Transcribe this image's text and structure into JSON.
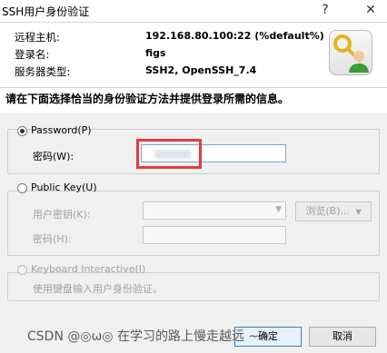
{
  "window": {
    "title": "SSH用户身份验证",
    "help_glyph": "?",
    "close_glyph": "✕"
  },
  "info": {
    "remote_host_label": "远程主机:",
    "remote_host_value": "192.168.80.100:22 (%default%)",
    "login_name_label": "登录名:",
    "login_name_value": "figs",
    "server_type_label": "服务器类型:",
    "server_type_value": "SSH2, OpenSSH_7.4",
    "key_icon": "keys-user-icon"
  },
  "instruction": "请在下面选择恰当的身份验证方法并提供登录所需的信息。",
  "password": {
    "radio_label": "Password(P)",
    "selected": true,
    "field_label": "密码(W):",
    "value_masked": ""
  },
  "public_key": {
    "radio_label": "Public Key(U)",
    "selected": false,
    "user_key_label": "用户密钥(K):",
    "user_key_value": "",
    "browse_label": "浏览(B)...",
    "passphrase_label": "密码(H):"
  },
  "keyboard_interactive": {
    "radio_label": "Keyboard Interactive(I)",
    "enabled": false,
    "description": "使用键盘输入用户身份验证。"
  },
  "buttons": {
    "ok_label": "确定",
    "cancel_label": "取消"
  },
  "watermark": "CSDN @◎ω◎ 在学习的路上慢走越远 ~~",
  "colors": {
    "highlight_box": "#e23b3b",
    "panel_bg": "#f0f0f0",
    "input_border": "#7aa7c7"
  }
}
